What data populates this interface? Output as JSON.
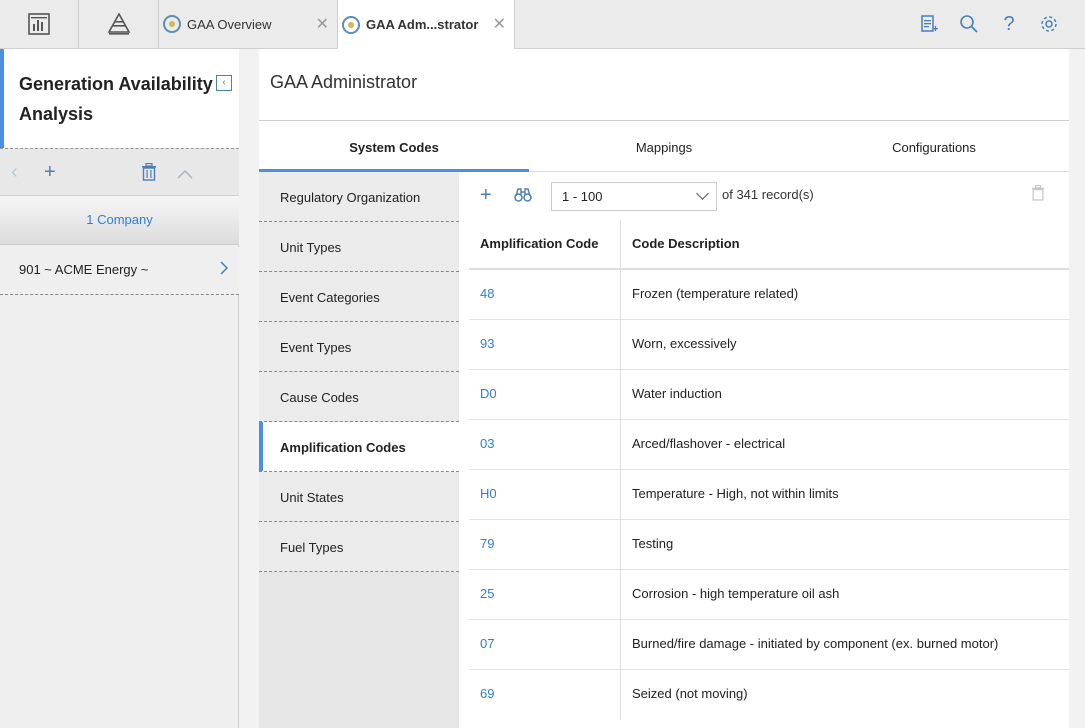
{
  "topbar": {
    "tabs": [
      {
        "label": "GAA Overview",
        "close": "✕"
      },
      {
        "label": "GAA Adm...strator",
        "close": "✕"
      }
    ],
    "icons": [
      "dashboard-icon",
      "hierarchy-icon",
      "report-icon",
      "search-icon",
      "help-icon",
      "settings-icon"
    ]
  },
  "left": {
    "title": "Generation Availability Analysis",
    "collapse_icon": "‹",
    "group_label": "1 Company",
    "items": [
      {
        "label": "901 ~ ACME Energy ~"
      }
    ]
  },
  "main": {
    "title": "GAA Administrator",
    "subtabs": [
      {
        "label": "System Codes"
      },
      {
        "label": "Mappings"
      },
      {
        "label": "Configurations"
      }
    ],
    "code_categories": [
      {
        "label": "Regulatory Organization"
      },
      {
        "label": "Unit Types"
      },
      {
        "label": "Event Categories"
      },
      {
        "label": "Event Types"
      },
      {
        "label": "Cause Codes"
      },
      {
        "label": "Amplification Codes"
      },
      {
        "label": "Unit States"
      },
      {
        "label": "Fuel Types"
      }
    ],
    "active_category": "Amplification Codes",
    "pager": {
      "range": "1 - 100",
      "records": "of 341  record(s)"
    },
    "table": {
      "headers": [
        "Amplification Code",
        "Code Description"
      ],
      "rows": [
        {
          "code": "48",
          "desc": "Frozen (temperature related)"
        },
        {
          "code": "93",
          "desc": "Worn, excessively"
        },
        {
          "code": "D0",
          "desc": "Water induction"
        },
        {
          "code": "03",
          "desc": "Arced/flashover - electrical"
        },
        {
          "code": "H0",
          "desc": "Temperature - High, not within limits"
        },
        {
          "code": "79",
          "desc": "Testing"
        },
        {
          "code": "25",
          "desc": "Corrosion - high temperature oil ash"
        },
        {
          "code": "07",
          "desc": "Burned/fire damage - initiated by component (ex. burned motor)"
        },
        {
          "code": "69",
          "desc": "Seized (not moving)"
        }
      ]
    }
  },
  "colors": {
    "accent": "#4a90e2",
    "link": "#2e7fd6",
    "icon": "#4a7fb8"
  }
}
